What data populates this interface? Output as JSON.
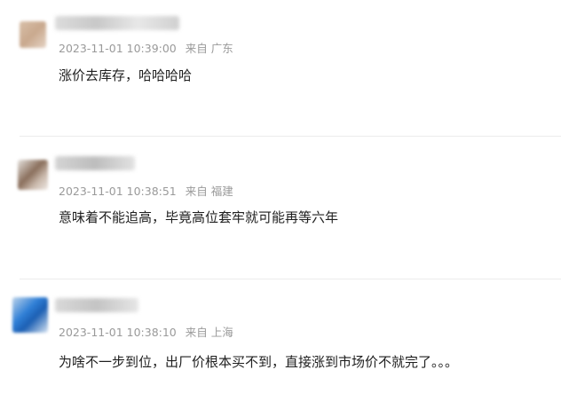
{
  "comments": [
    {
      "time": "2023-11-01 10:39:00",
      "source_prefix": "来自",
      "location": "广东",
      "text": "涨价去库存，哈哈哈哈"
    },
    {
      "time": "2023-11-01 10:38:51",
      "source_prefix": "来自",
      "location": "福建",
      "text": "意味着不能追高，毕竟高位套牢就可能再等六年"
    },
    {
      "time": "2023-11-01 10:38:10",
      "source_prefix": "来自",
      "location": "上海",
      "text": "为啥不一步到位，出厂价根本买不到，直接涨到市场价不就完了。。。"
    }
  ]
}
